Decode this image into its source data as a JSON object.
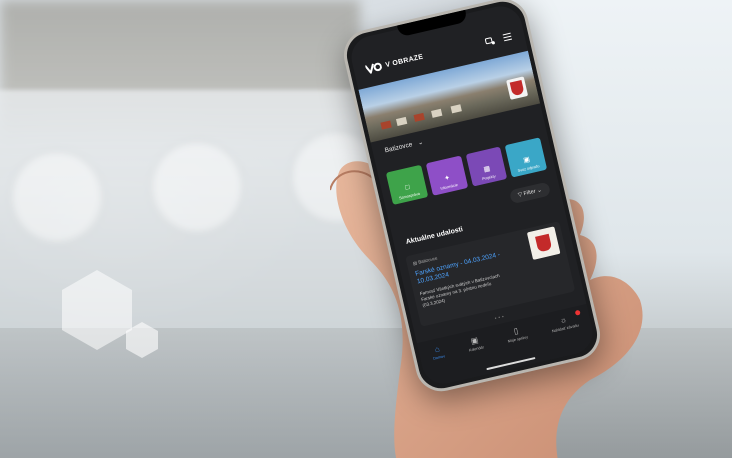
{
  "app": {
    "brand": "V OBRAZE"
  },
  "location": {
    "name": "Batizovce"
  },
  "tiles": [
    {
      "label": "Samospráva",
      "icon": "chat-icon",
      "color": "#3ea34a"
    },
    {
      "label": "Informácie",
      "icon": "megaphone-icon",
      "color": "#8e4fc7"
    },
    {
      "label": "Projekty",
      "icon": "grid-icon",
      "color": "#7b49b6"
    },
    {
      "label": "Svoz odpadu",
      "icon": "calendar-icon",
      "color": "#3aa7c7"
    }
  ],
  "filter": {
    "label": "Filter"
  },
  "events": {
    "title": "Aktuálne udalosti",
    "items": [
      {
        "source": "Batizovce",
        "title": "Farské oznamy - 04.03.2024 - 10.03.2024",
        "text": "Farnosť Všetkých svätých v Batizovciach Farské oznamy na 3. pôstnu nedeľu (03.3.2024)"
      }
    ]
  },
  "tabbar": [
    {
      "label": "Domov",
      "icon": "home-icon",
      "active": true
    },
    {
      "label": "Kalendár",
      "icon": "calendar-icon",
      "active": false
    },
    {
      "label": "Moje správy",
      "icon": "bookmark-icon",
      "active": false
    },
    {
      "label": "Nahlásiť závadu",
      "icon": "bug-icon",
      "active": false
    }
  ]
}
